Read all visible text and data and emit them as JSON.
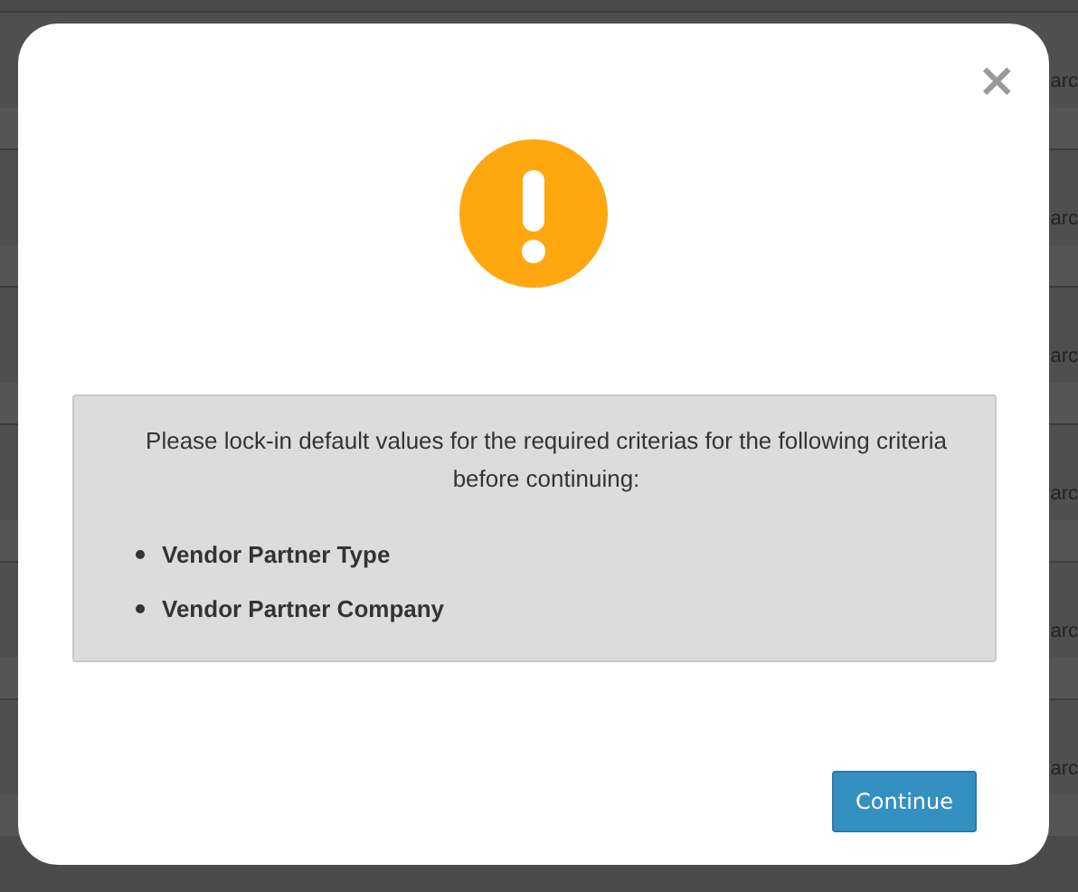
{
  "background": {
    "rows": [
      {
        "cell": "arc"
      },
      {
        "cell": "arc"
      },
      {
        "cell": "arc"
      },
      {
        "cell": "arc"
      },
      {
        "cell": "arc"
      },
      {
        "cell": "arc"
      }
    ]
  },
  "dialog": {
    "close": "×",
    "message": "Please lock-in default values for the required criterias for the following criteria before continuing:",
    "items": [
      "Vendor Partner Type",
      "Vendor Partner Company"
    ],
    "button": "Continue"
  }
}
